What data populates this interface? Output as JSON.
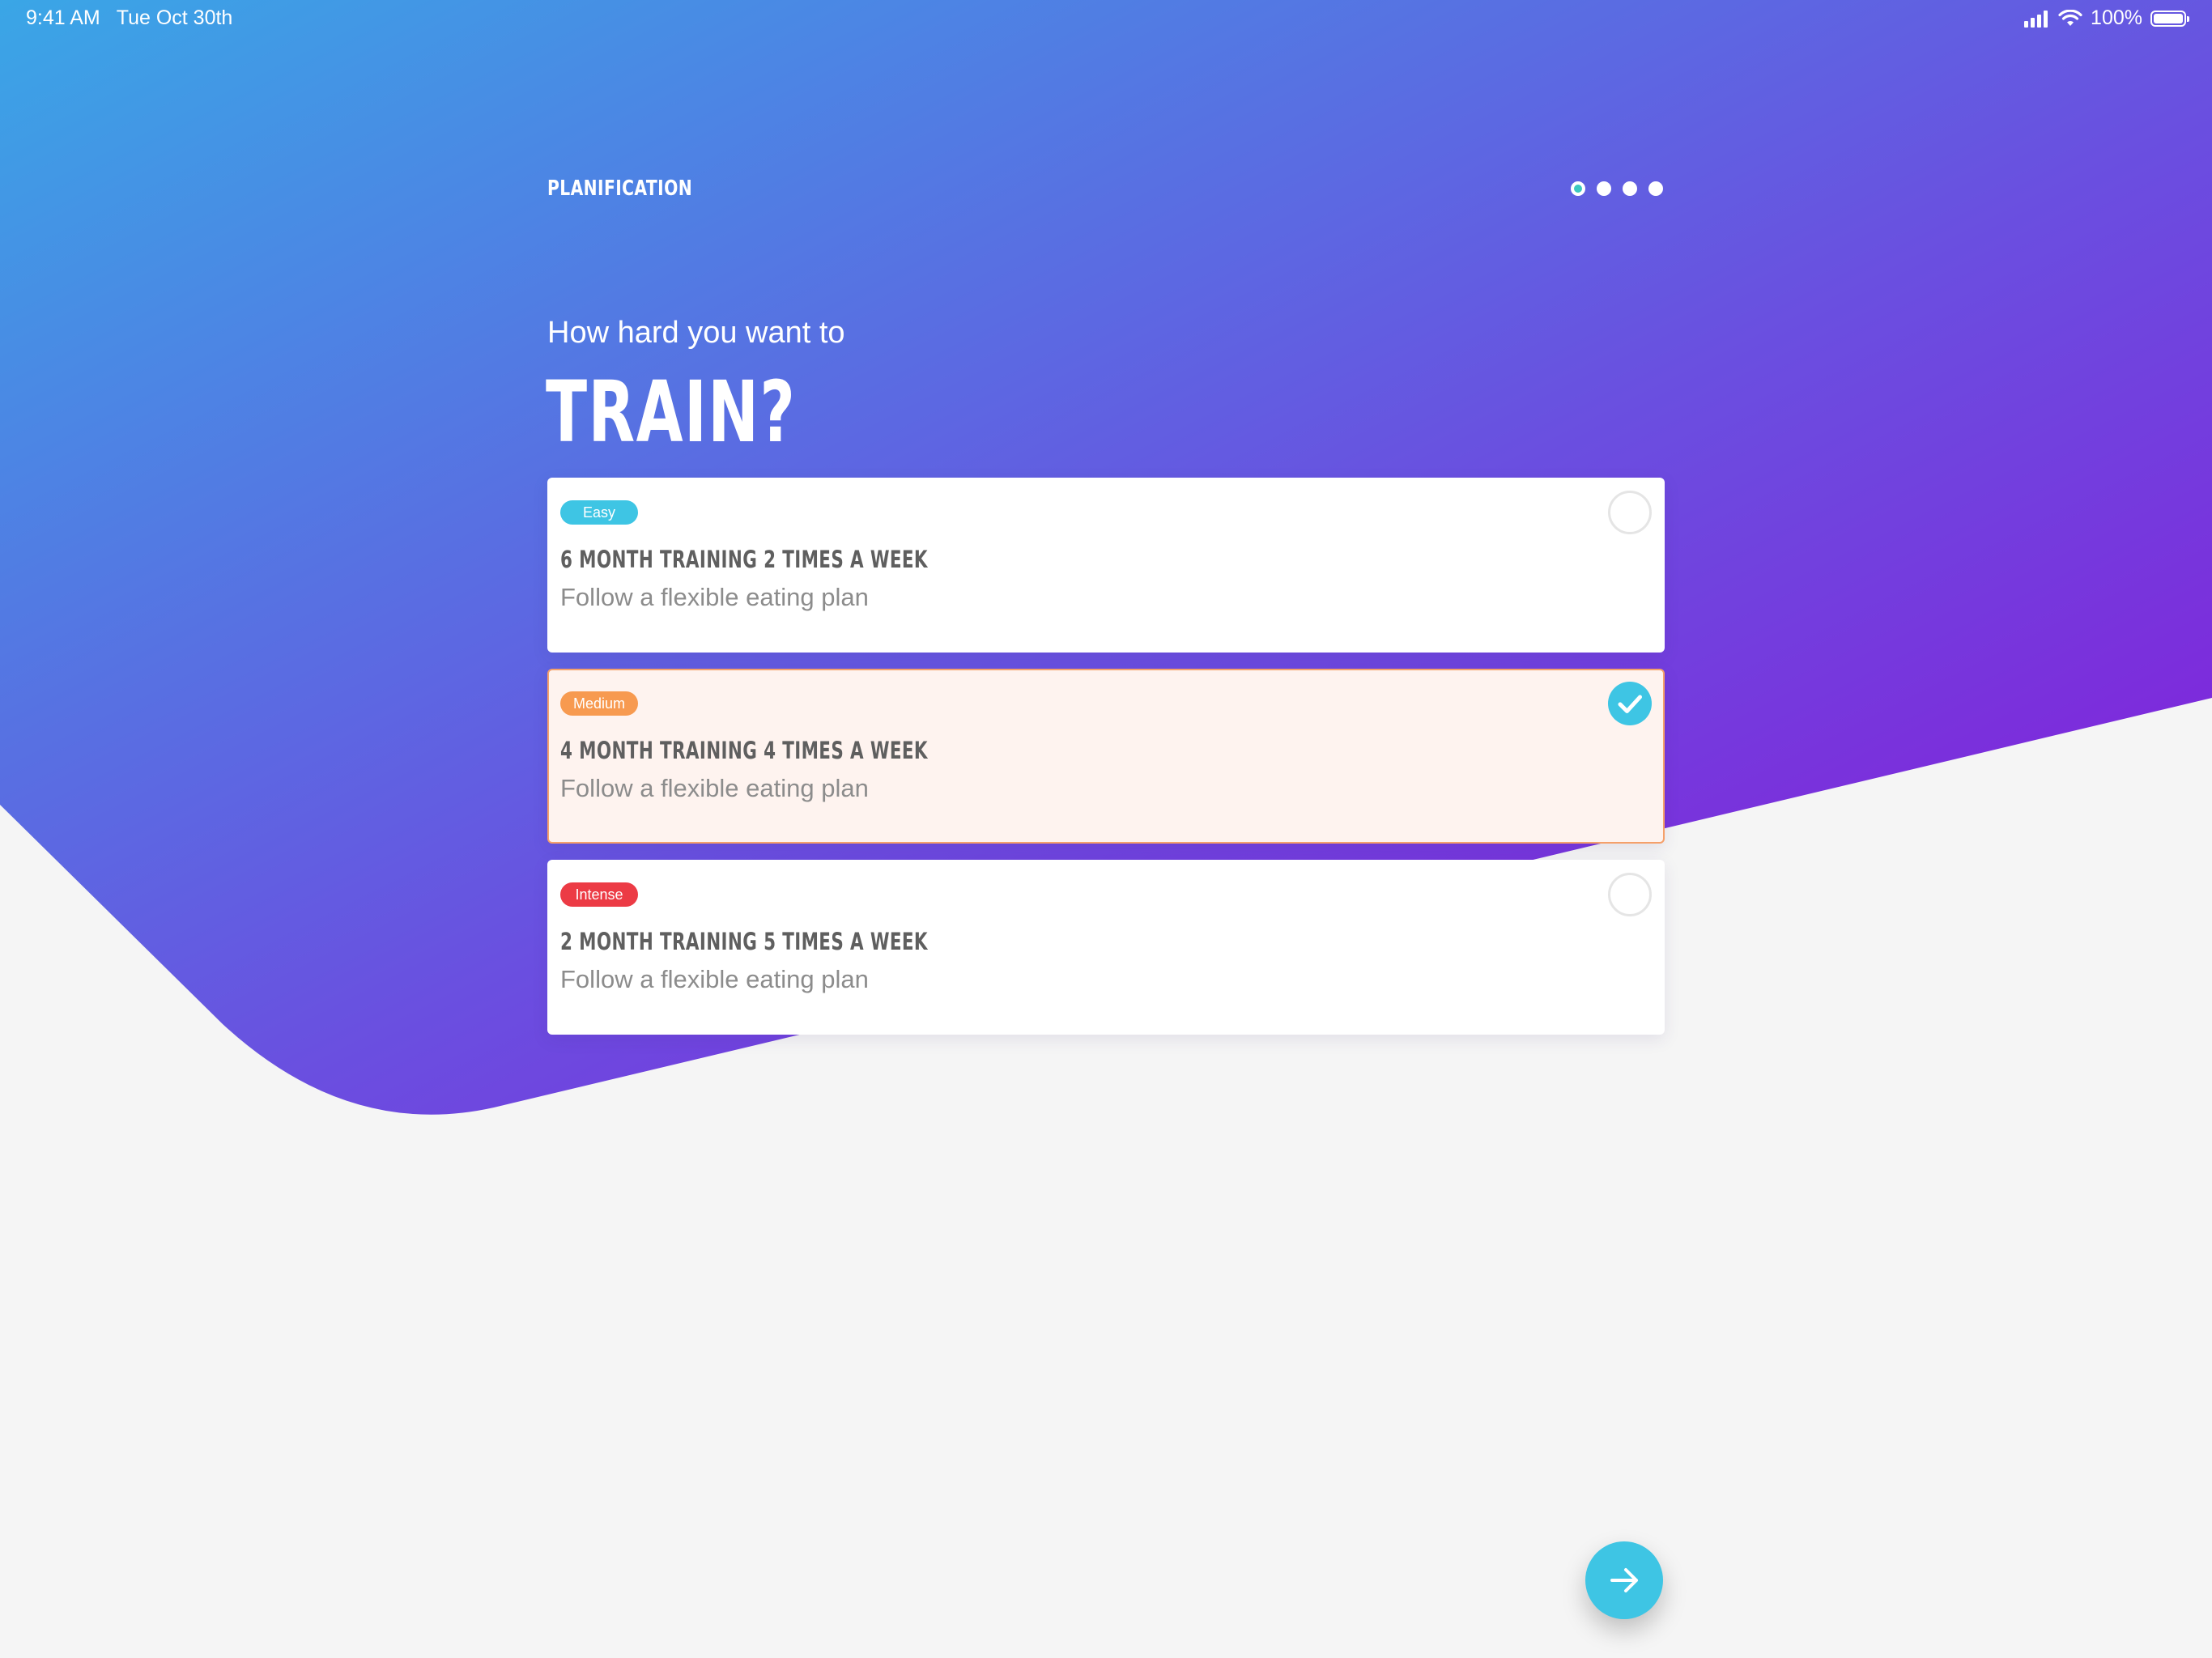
{
  "status_bar": {
    "time": "9:41 AM",
    "date": "Tue Oct 30th",
    "battery": "100%"
  },
  "header": {
    "title": "PLANIFICATION",
    "pager": {
      "total": 4,
      "active": 1
    }
  },
  "question": {
    "subtitle": "How hard you want to",
    "title": "TRAIN?"
  },
  "options": [
    {
      "badge": "Easy",
      "badge_color": "#3ec5e4",
      "title": "6 MONTH TRAINING 2 TIMES A WEEK",
      "subtitle": "Follow a flexible eating plan",
      "selected": false
    },
    {
      "badge": "Medium",
      "badge_color": "#f79a50",
      "title": "4 MONTH TRAINING 4 TIMES A WEEK",
      "subtitle": "Follow a flexible eating plan",
      "selected": true
    },
    {
      "badge": "Intense",
      "badge_color": "#ec3b45",
      "title": "2 MONTH TRAINING 5 TIMES A WEEK",
      "subtitle": "Follow a flexible eating plan",
      "selected": false
    }
  ],
  "colors": {
    "gradient_start": "#3aa6e6",
    "gradient_end": "#7c1fe0",
    "accent": "#3ec5e4",
    "background": "#f5f5f5"
  },
  "icons": {
    "next": "arrow-right-icon",
    "check": "checkmark-icon",
    "signal": "signal-icon",
    "wifi": "wifi-icon",
    "battery": "battery-icon"
  }
}
